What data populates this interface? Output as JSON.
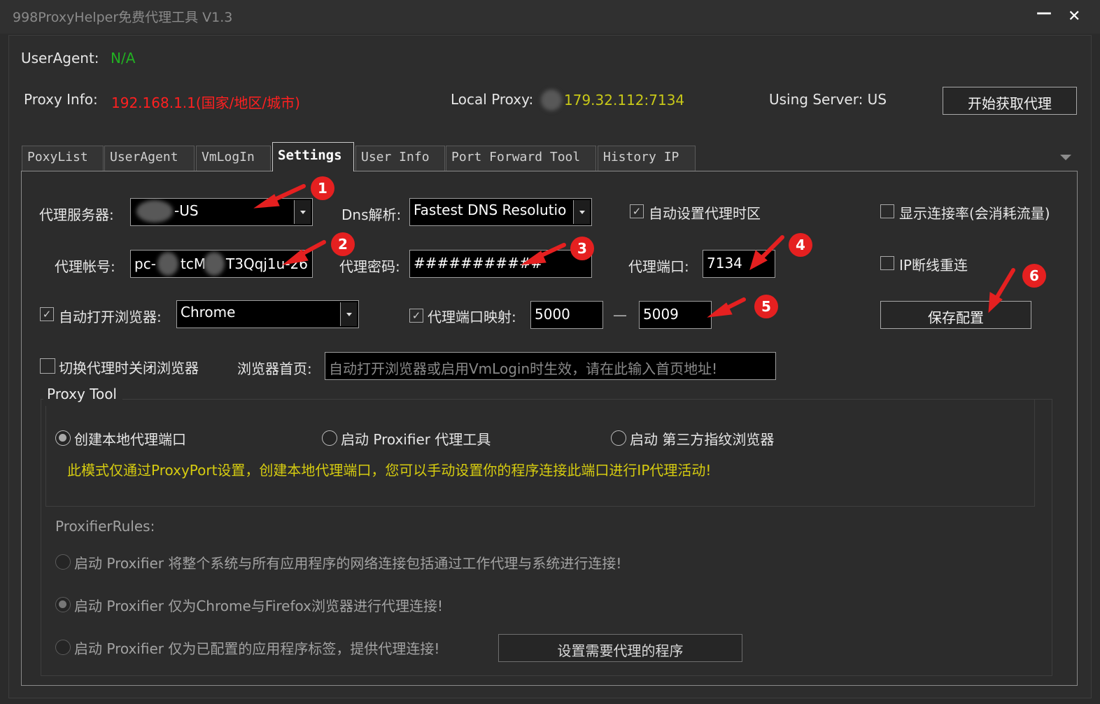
{
  "window": {
    "title": "998ProxyHelper免费代理工具 V1.3",
    "minimize_glyph": "—",
    "close_glyph": "✕"
  },
  "header": {
    "useragent_label": "UserAgent:",
    "useragent_value": "N/A",
    "proxyinfo_label": "Proxy Info:",
    "proxyinfo_value": "192.168.1.1(国家/地区/城市)",
    "localproxy_label": "Local Proxy:",
    "localproxy_value": "179.32.112:7134",
    "server_text": "Using Server: US",
    "fetch_button": "开始获取代理"
  },
  "tabs": [
    {
      "label": "PoxyList"
    },
    {
      "label": "UserAgent"
    },
    {
      "label": "VmLogIn"
    },
    {
      "label": "Settings",
      "active": true
    },
    {
      "label": "User Info"
    },
    {
      "label": "Port Forward Tool"
    },
    {
      "label": "History IP"
    }
  ],
  "settings": {
    "server_label": "代理服务器:",
    "server_value": "-US",
    "dns_label": "Dns解析:",
    "dns_value": "Fastest DNS Resolutio",
    "auto_timezone_label": "自动设置代理时区",
    "auto_timezone_checked": true,
    "show_rate_label": "显示连接率(会消耗流量)",
    "show_rate_checked": false,
    "account_label": "代理帐号:",
    "account_value_a": "pc-",
    "account_value_b": "tcM",
    "account_value_c": "T3Qqj1u-26",
    "password_label": "代理密码:",
    "password_value": "###########",
    "port_label": "代理端口:",
    "port_value": "7134",
    "reconnect_label": "IP断线重连",
    "reconnect_checked": false,
    "auto_browser_label": "自动打开浏览器:",
    "auto_browser_checked": true,
    "browser_value": "Chrome",
    "port_mapping_label": "代理端口映射:",
    "port_mapping_checked": true,
    "port_from": "5000",
    "port_dash": "—",
    "port_to": "5009",
    "save_button": "保存配置",
    "close_browser_label": "切换代理时关闭浏览器",
    "close_browser_checked": false,
    "homepage_label": "浏览器首页:",
    "homepage_placeholder": "自动打开浏览器或启用VmLogin时生效，请在此输入首页地址!"
  },
  "proxy_tool": {
    "legend": "Proxy Tool",
    "options": [
      {
        "label": "创建本地代理端口",
        "selected": true
      },
      {
        "label": "启动 Proxifier 代理工具",
        "selected": false
      },
      {
        "label": "启动 第三方指纹浏览器",
        "selected": false
      }
    ],
    "notice": "此模式仅通过ProxyPort设置，创建本地代理端口，您可以手动设置你的程序连接此端口进行IP代理活动!",
    "rules_label": "ProxifierRules:",
    "rules": [
      {
        "label": "启动 Proxifier 将整个系统与所有应用程序的网络连接包括通过工作代理与系统进行连接!",
        "selected": false
      },
      {
        "label": "启动 Proxifier 仅为Chrome与Firefox浏览器进行代理连接!",
        "selected": true
      },
      {
        "label": "启动 Proxifier 仅为已配置的应用程序标签，提供代理连接!",
        "selected": false
      }
    ],
    "set_programs_button": "设置需要代理的程序"
  },
  "annotations": [
    "1",
    "2",
    "3",
    "4",
    "5",
    "6"
  ],
  "colors": {
    "background": "#2b2b2b",
    "useragent_value": "#22b022",
    "proxyinfo_value": "#ff2020",
    "localproxy_value": "#c8c818",
    "notice": "#d6cc10",
    "annotation": "#e52020"
  }
}
